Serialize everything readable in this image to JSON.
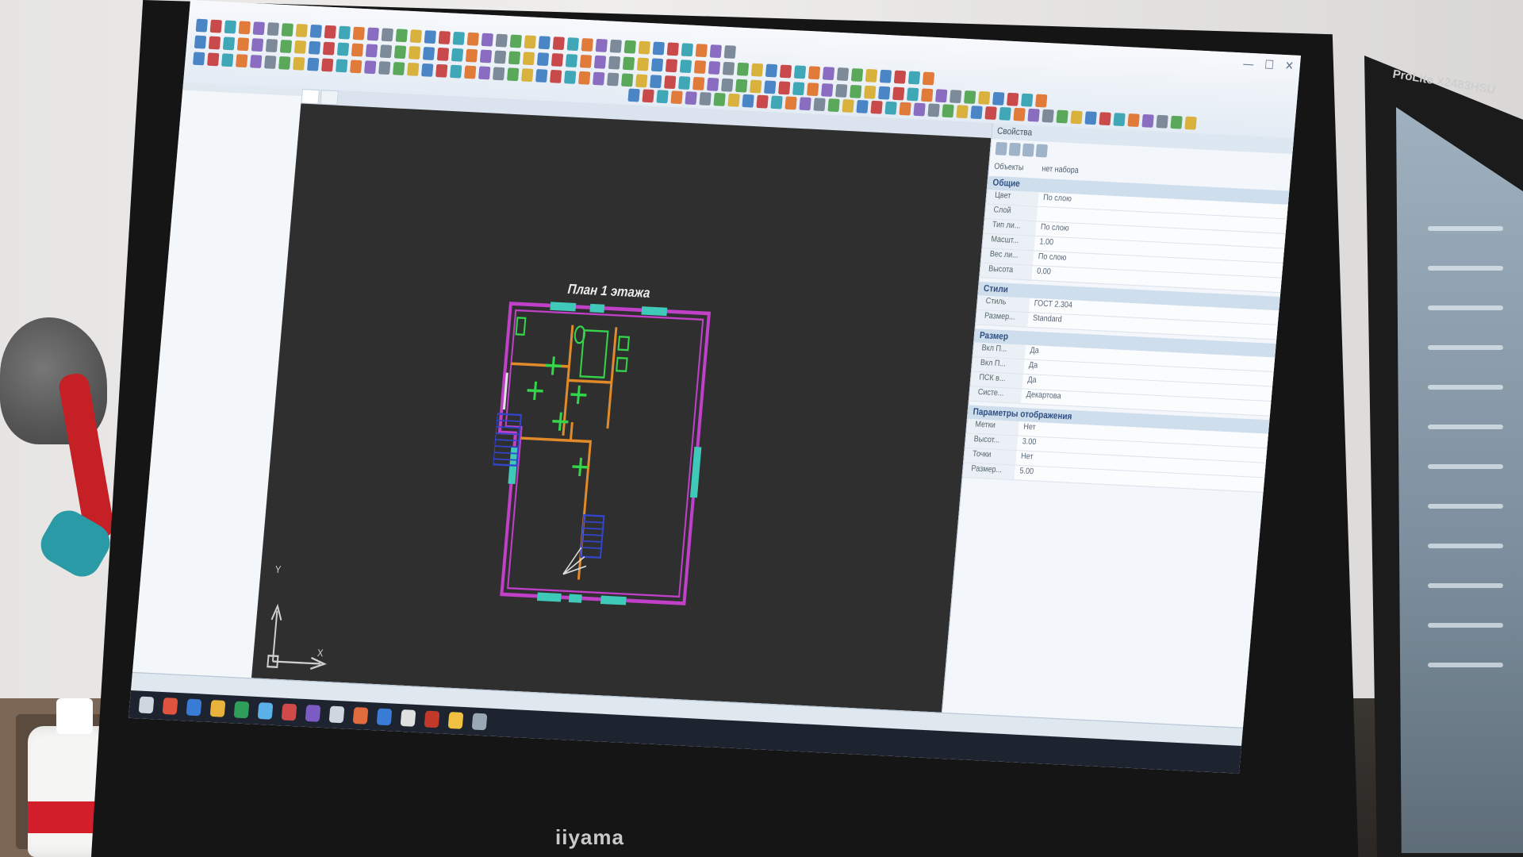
{
  "monitor": {
    "brand": "iiyama"
  },
  "right_monitor": {
    "brand": "ProLite X2483HSU"
  },
  "bottle": {
    "label": ""
  },
  "app": {
    "menu": [
      "",
      "",
      "",
      "",
      "",
      ""
    ],
    "window_controls": {
      "minimize": "—",
      "maximize": "☐",
      "close": "✕"
    }
  },
  "tree": {
    "title": "",
    "items": [
      "",
      "",
      "",
      "",
      "",
      "",
      "",
      "",
      "",
      "",
      "",
      "",
      "",
      "",
      "",
      "",
      "",
      "",
      "",
      "",
      "",
      "",
      "",
      "",
      "",
      "",
      "",
      "",
      "",
      "",
      "",
      ""
    ]
  },
  "doc_tabs": [
    "",
    ""
  ],
  "canvas": {
    "plan_title": "План 1 этажа",
    "ucs_x": "X",
    "ucs_y": "Y"
  },
  "properties": {
    "header": "Свойства",
    "filter_label": "Объекты",
    "filter_value": "нет набора",
    "sections": [
      {
        "title": "Общие",
        "rows": [
          {
            "key": "Цвет",
            "value": "По слою"
          },
          {
            "key": "Слой",
            "value": ""
          },
          {
            "key": "Тип ли...",
            "value": "По слою"
          },
          {
            "key": "Масшт...",
            "value": "1.00"
          },
          {
            "key": "Вес ли...",
            "value": "По слою"
          },
          {
            "key": "Высота",
            "value": "0.00"
          }
        ]
      },
      {
        "title": "Стили",
        "rows": [
          {
            "key": "Стиль",
            "value": "ГОСТ 2.304"
          },
          {
            "key": "Размер...",
            "value": "Standard"
          }
        ]
      },
      {
        "title": "Размер",
        "rows": [
          {
            "key": "Вкл П...",
            "value": "Да"
          },
          {
            "key": "Вкл П...",
            "value": "Да"
          },
          {
            "key": "ПСК в...",
            "value": "Да"
          },
          {
            "key": "Систе...",
            "value": "Декартова"
          }
        ]
      },
      {
        "title": "Параметры отображения",
        "rows": [
          {
            "key": "Метки",
            "value": "Нет"
          },
          {
            "key": "Высот...",
            "value": "3.00"
          },
          {
            "key": "Точки",
            "value": "Нет"
          },
          {
            "key": "Размер...",
            "value": "5.00"
          }
        ]
      }
    ]
  },
  "status_bar": [
    "",
    "",
    "",
    ""
  ],
  "colors": {
    "canvas_bg": "#2f2f30",
    "wall_outer": "#c040c8",
    "wall_inner": "#e08a2a",
    "windows": "#3fc9b8",
    "fixtures": "#33d64a",
    "stairs": "#3344cc"
  }
}
